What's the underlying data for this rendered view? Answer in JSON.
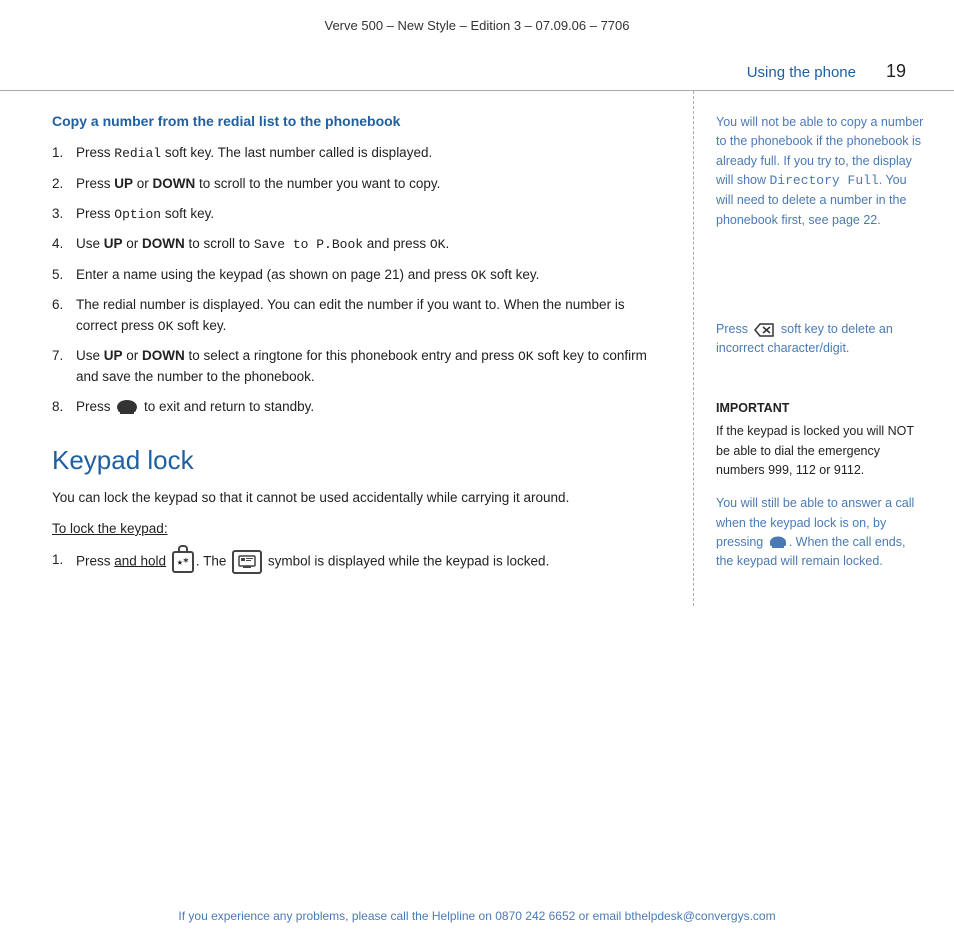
{
  "header": {
    "title": "Verve 500 – New Style – Edition 3 – 07.09.06 – 7706"
  },
  "top": {
    "section_label": "Using the phone",
    "page_number": "19"
  },
  "left": {
    "copy_section": {
      "title": "Copy a number from the redial list to the phonebook",
      "steps": [
        {
          "num": "1.",
          "text_parts": [
            {
              "type": "text",
              "val": "Press "
            },
            {
              "type": "mono",
              "val": "Redial"
            },
            {
              "type": "text",
              "val": " soft key. The last number called is displayed."
            }
          ],
          "text": "Press Redial soft key. The last number called is displayed."
        },
        {
          "num": "2.",
          "text": "Press UP or DOWN to scroll to the number you want to copy.",
          "has_bold": true,
          "bold_words": [
            "UP",
            "DOWN"
          ]
        },
        {
          "num": "3.",
          "text": "Press Option soft key.",
          "mono_word": "Option"
        },
        {
          "num": "4.",
          "text": "Use UP or DOWN to scroll to Save to P.Book and press OK.",
          "has_bold": true,
          "bold_words": [
            "UP",
            "DOWN"
          ],
          "mono_words": [
            "Save to P.Book",
            "OK"
          ]
        },
        {
          "num": "5.",
          "text": "Enter a name using the keypad (as shown on page 21) and press OK soft key.",
          "mono_word": "OK"
        },
        {
          "num": "6.",
          "text": "The redial number is displayed. You can edit the number if you want to. When the number is correct press OK soft key.",
          "mono_word": "OK"
        },
        {
          "num": "7.",
          "text": "Use UP or DOWN to select a ringtone for this phonebook entry and press OK soft key to confirm and save the number to the phonebook.",
          "has_bold": true,
          "bold_words": [
            "UP",
            "DOWN"
          ],
          "mono_word": "OK"
        },
        {
          "num": "8.",
          "text": "Press [icon] to exit and return to standby."
        }
      ]
    },
    "keypad_lock": {
      "title": "Keypad lock",
      "description": "You can lock the keypad so that it cannot be used accidentally while carrying it around.",
      "to_lock_label": "To lock the keypad:",
      "steps": [
        {
          "num": "1.",
          "text": "Press and hold [icon]. The [icon2] symbol is displayed while the keypad is locked."
        }
      ]
    }
  },
  "right": {
    "note1": "You will not be able to copy a number to the phonebook if the phonebook is already full. If you try to, the display will show Directory Full. You will need to delete a number in the phonebook first, see page 22.",
    "note2": "Press [backspace] soft key to delete an incorrect character/digit.",
    "important_label": "IMPORTANT",
    "important_text": "If the keypad is locked you will NOT be able to dial the emergency numbers 999, 112 or 9112.",
    "important_blue": "You will still be able to answer a call when the keypad lock is on, by pressing [icon]. When the call ends, the keypad will remain locked."
  },
  "footer": {
    "text": "If you experience any problems, please call the Helpline on 0870 242 6652 or email bthelpdesk@convergys.com"
  }
}
